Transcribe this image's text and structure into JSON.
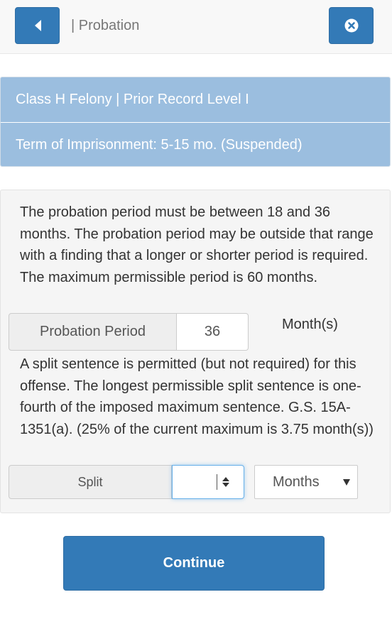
{
  "header": {
    "title": "| Probation",
    "back_icon": "caret-left-icon",
    "close_icon": "times-circle-icon"
  },
  "info": {
    "offense": "Class H Felony | Prior Record Level I",
    "term": "Term of Imprisonment: 5-15 mo. (Suspended)"
  },
  "probation": {
    "description": "The probation period must be between 18 and 36 months. The probation period may be outside that range with a finding that a longer or shorter period is required. The maximum permissible period is 60 months.",
    "label": "Probation Period",
    "value": "36",
    "unit": "Month(s)"
  },
  "split": {
    "description": "A split sentence is permitted (but not required) for this offense. The longest permissible split sentence is one-fourth of the imposed maximum sentence. G.S. 15A-1351(a). (25% of the current maximum is 3.75 month(s))",
    "label": "Split",
    "value": "",
    "unit_selected": "Months"
  },
  "actions": {
    "continue_label": "Continue"
  },
  "colors": {
    "primary": "#337ab7",
    "info_bar": "#9bbedf"
  }
}
